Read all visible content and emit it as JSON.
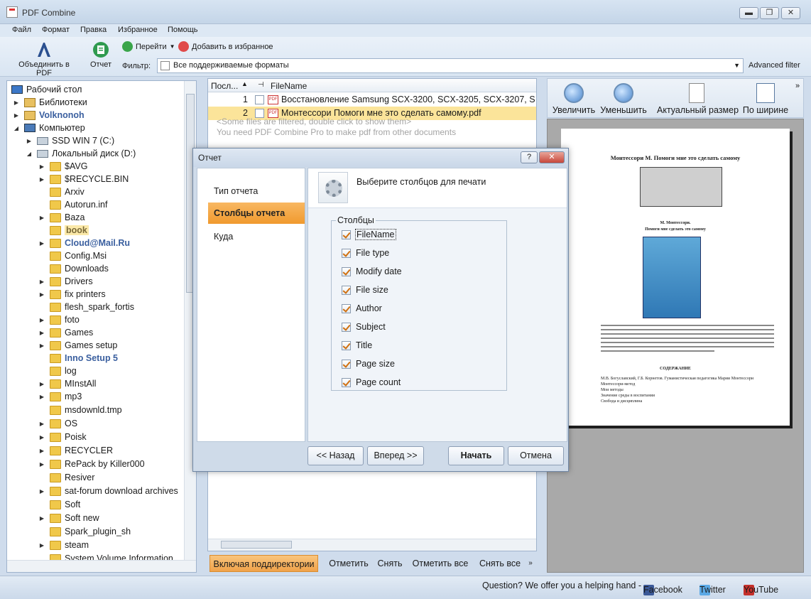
{
  "window": {
    "title": "PDF Combine",
    "minimize": "▬",
    "restore": "❐",
    "close": "✕"
  },
  "menu": [
    "Файл",
    "Формат",
    "Правка",
    "Избранное",
    "Помощь"
  ],
  "toolbar": {
    "combine_label": "Объединить в PDF",
    "report_label": "Отчет",
    "goto_label": "Перейти",
    "favorite_label": "Добавить в избранное",
    "filter_label": "Фильтр:",
    "filter_value": "Все поддерживаемые форматы",
    "advanced_filter": "Advanced filter"
  },
  "tree": {
    "items": [
      {
        "label": "Рабочий стол"
      },
      {
        "label": "Библиотеки"
      },
      {
        "label": "Volknonoh"
      },
      {
        "label": "Компьютер"
      },
      {
        "label": "SSD WIN 7 (C:)"
      },
      {
        "label": "Локальный диск (D:)"
      },
      {
        "label": "$AVG"
      },
      {
        "label": "$RECYCLE.BIN"
      },
      {
        "label": "Arxiv"
      },
      {
        "label": "Autorun.inf"
      },
      {
        "label": "Baza"
      },
      {
        "label": "book"
      },
      {
        "label": "Cloud@Mail.Ru"
      },
      {
        "label": "Config.Msi"
      },
      {
        "label": "Downloads"
      },
      {
        "label": "Drivers"
      },
      {
        "label": "fix printers"
      },
      {
        "label": "flesh_spark_fortis"
      },
      {
        "label": "foto"
      },
      {
        "label": "Games"
      },
      {
        "label": "Games setup"
      },
      {
        "label": "Inno Setup 5"
      },
      {
        "label": "log"
      },
      {
        "label": "MInstAll"
      },
      {
        "label": "mp3"
      },
      {
        "label": "msdownld.tmp"
      },
      {
        "label": "OS"
      },
      {
        "label": "Poisk"
      },
      {
        "label": "RECYCLER"
      },
      {
        "label": "RePack by Killer000"
      },
      {
        "label": "Resiver"
      },
      {
        "label": "sat-forum download archives"
      },
      {
        "label": "Soft"
      },
      {
        "label": "Soft new"
      },
      {
        "label": "Spark_plugin_sh"
      },
      {
        "label": "steam"
      },
      {
        "label": "System Volume Information"
      }
    ]
  },
  "filelist": {
    "col_order": "Посл...",
    "col_filename": "FileName",
    "rows": [
      {
        "num": "1",
        "name": "Восстановление Samsung SCX-3200, SCX-3205, SCX-3207, S"
      },
      {
        "num": "2",
        "name": "Монтессори Помоги мне это сделать самому.pdf"
      }
    ],
    "note1": "<Some files are filtered, double click to show them>",
    "note2": "You need PDF Combine Pro to make pdf from other documents"
  },
  "bottom_bar": {
    "include_subdirs": "Включая поддиректории",
    "mark": "Отметить",
    "unmark": "Снять",
    "mark_all": "Отметить все",
    "unmark_all": "Снять все"
  },
  "preview": {
    "zoom_in": "Увеличить",
    "zoom_out": "Уменьшить",
    "actual_size": "Актуальный размер",
    "fit_width": "По ширине",
    "page_title": "Монтессори М. Помоги мне это сделать самому",
    "page_author": "М. Монтессори.",
    "page_subtitle": "Помоги мне сделать это самому",
    "page_contents": "СОДЕРЖАНИЕ",
    "contents_lines": [
      "М.В. Богуславский, Г.Б. Корнетов.   Гуманистическая педагогика Марии Монтессори",
      "Монтессори-метод",
      "Мои методы",
      "Значение среды в воспитании",
      "Свобода и дисциплина"
    ]
  },
  "status": {
    "question": "Question? We offer you a helping hand -",
    "facebook": "Facebook",
    "twitter": "Twitter",
    "youtube": "YouTube"
  },
  "dialog": {
    "title": "Отчет",
    "help": "?",
    "close": "✕",
    "nav": [
      "Тип отчета",
      "Столбцы отчета",
      "Куда"
    ],
    "header": "Выберите столбцов для печати",
    "group_label": "Столбцы",
    "columns": [
      "FileName",
      "File type",
      "Modify date",
      "File size",
      "Author",
      "Subject",
      "Title",
      "Page size",
      "Page count"
    ],
    "back": "<< Назад",
    "next": "Вперед >>",
    "start": "Начать",
    "cancel": "Отмена"
  }
}
